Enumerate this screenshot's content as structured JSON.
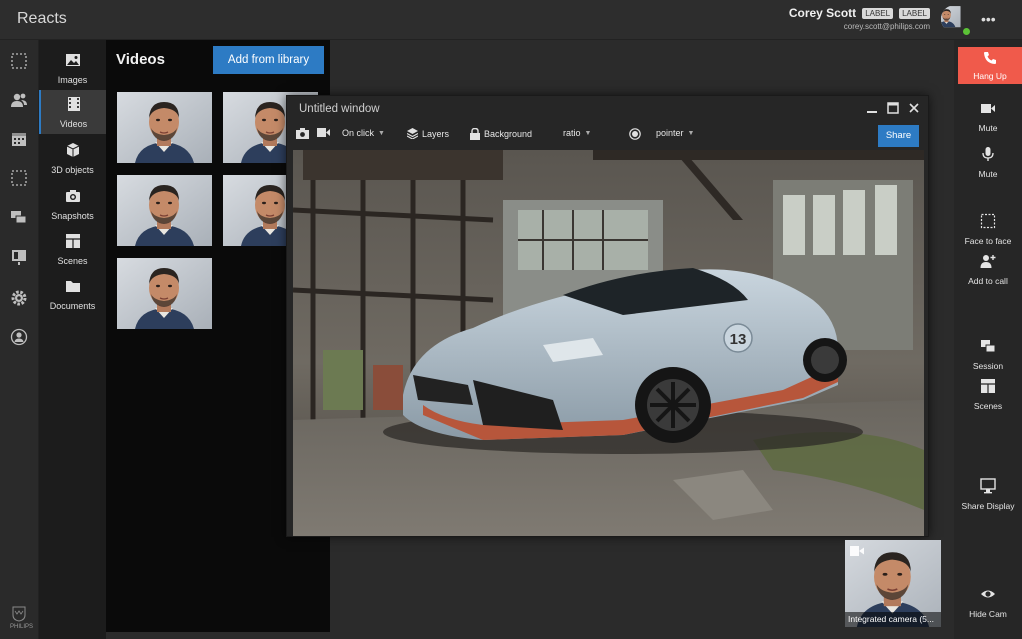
{
  "app": {
    "title": "Reacts"
  },
  "user": {
    "name": "Corey Scott",
    "badges": [
      "LABEL",
      "LABEL"
    ],
    "email": "corey.scott@philips.com",
    "status": "online"
  },
  "left_rail": {
    "icons": [
      "select-icon",
      "contacts-icon",
      "calendar-icon",
      "select-icon",
      "chat-icon",
      "dashboard-icon",
      "settings-icon",
      "profile-icon"
    ],
    "brand": "PHILIPS"
  },
  "library_sidebar": {
    "items": [
      {
        "label": "Images",
        "icon": "image-icon"
      },
      {
        "label": "Videos",
        "icon": "film-icon",
        "active": true
      },
      {
        "label": "3D objects",
        "icon": "cube-icon"
      },
      {
        "label": "Snapshots",
        "icon": "camera-icon"
      },
      {
        "label": "Scenes",
        "icon": "scenes-icon"
      },
      {
        "label": "Documents",
        "icon": "folder-icon"
      }
    ]
  },
  "library_panel": {
    "title": "Videos",
    "add_button": "Add from library",
    "thumb_count": 5
  },
  "window": {
    "title": "Untitled window",
    "toolbar": {
      "on_click": "On click",
      "layers": "Layers",
      "background": "Background",
      "ratio": "ratio",
      "pointer": "pointer",
      "share": "Share"
    }
  },
  "right_rail": {
    "hang_up": "Hang Up",
    "items": [
      {
        "label": "Mute",
        "icon": "video-camera-icon"
      },
      {
        "label": "Mute",
        "icon": "microphone-icon"
      },
      {
        "label": "Face to face",
        "icon": "face-to-face-icon"
      },
      {
        "label": "Add to call",
        "icon": "add-person-icon"
      },
      {
        "label": "Session",
        "icon": "session-icon"
      },
      {
        "label": "Scenes",
        "icon": "scenes-icon"
      },
      {
        "label": "Share Display",
        "icon": "monitor-icon"
      },
      {
        "label": "Hide Cam",
        "icon": "eye-icon"
      }
    ]
  },
  "self_view": {
    "caption": "Integrated camera (5..."
  },
  "colors": {
    "accent": "#2d7bc4",
    "hangup": "#f05a4b",
    "online": "#5bc236"
  }
}
